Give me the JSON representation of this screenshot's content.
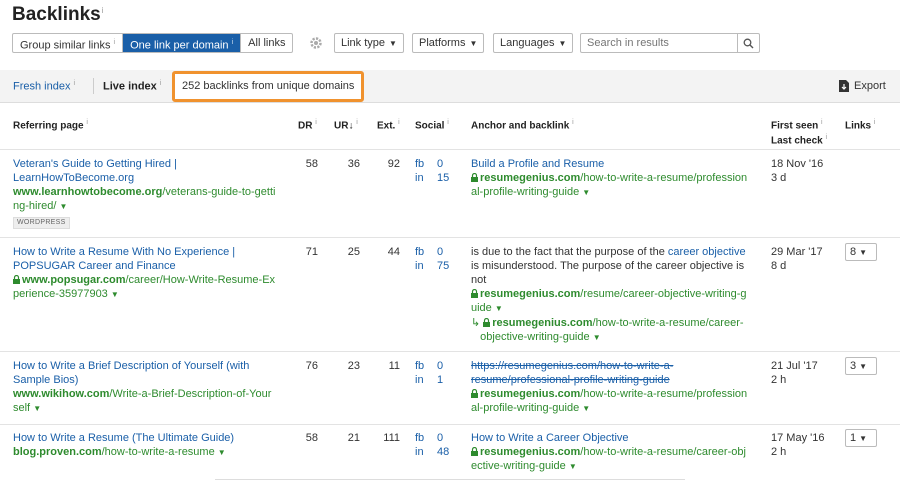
{
  "page": {
    "title": "Backlinks"
  },
  "toolbar": {
    "group_similar": "Group similar links",
    "one_link": "One link per domain",
    "all_links": "All links",
    "link_type": "Link type",
    "platforms": "Platforms",
    "languages": "Languages",
    "search_placeholder": "Search in results"
  },
  "subbar": {
    "fresh": "Fresh index",
    "live": "Live index",
    "count": "252 backlinks from unique domains",
    "export": "Export"
  },
  "columns": {
    "referring": "Referring page",
    "dr": "DR",
    "ur": "UR",
    "ur_sort": "↓",
    "ext": "Ext.",
    "social": "Social",
    "anchor": "Anchor and backlink",
    "first_seen": "First seen",
    "last_check": "Last check",
    "links": "Links"
  },
  "info_mark": "i",
  "rows": [
    {
      "title1": "Veteran's Guide to Getting Hired |",
      "title2": "LearnHowToBecome.org",
      "url_domain": "www.learnhowtobecome.org",
      "url_path1": "/veterans-guide-to-getti",
      "url_path2": "ng-hired/",
      "badge": "WORDPRESS",
      "dr": "58",
      "ur": "36",
      "ext": "92",
      "fb_label": "fb",
      "fb": "0",
      "in_label": "in",
      "in": "15",
      "anchor": "Build a Profile and Resume",
      "bl_domain": "resumegenius.com",
      "bl_path1": "/how-to-write-a-resume/profession",
      "bl_path2": "al-profile-writing-guide",
      "first_seen": "18 Nov '16",
      "last_check": "3 d"
    },
    {
      "title1": "How to Write a Resume With No Experience |",
      "title2": "POPSUGAR Career and Finance",
      "url_domain": "www.popsugar.com",
      "url_path1": "/career/How-Write-Resume-Ex",
      "url_path2": "perience-35977903",
      "dr": "71",
      "ur": "25",
      "ext": "44",
      "fb_label": "fb",
      "fb": "0",
      "in_label": "in",
      "in": "75",
      "ctx1": "is due to the fact that the purpose of the ",
      "ctx_link": "career objective",
      "ctx2": "is misunderstood. The purpose of the career objective is",
      "ctx3": "not",
      "bl_domain": "resumegenius.com",
      "bl_path1": "/resume/career-objective-writing-g",
      "bl_path2": "uide",
      "redir_domain": "resumegenius.com",
      "redir_path1": "/how-to-write-a-resume/career-",
      "redir_path2": "objective-writing-guide",
      "first_seen": "29 Mar '17",
      "last_check": "8 d",
      "links": "8"
    },
    {
      "title1": "How to Write a Brief Description of Yourself (with",
      "title2": "Sample Bios)",
      "url_domain": "www.wikihow.com",
      "url_path1": "/Write-a-Brief-Description-of-Your",
      "url_path2": "self",
      "dr": "76",
      "ur": "23",
      "ext": "11",
      "fb_label": "fb",
      "fb": "0",
      "in_label": "in",
      "in": "1",
      "old1": "https://resumegenius.com/how-to-write-a-",
      "old2": "resume/professional-profile-writing-guide",
      "bl_domain": "resumegenius.com",
      "bl_path1": "/how-to-write-a-resume/profession",
      "bl_path2": "al-profile-writing-guide",
      "first_seen": "21 Jul '17",
      "last_check": "2 h",
      "links": "3"
    },
    {
      "title1": "How to Write a Resume (The Ultimate Guide)",
      "url_domain": "blog.proven.com",
      "url_path1": "/how-to-write-a-resume",
      "dr": "58",
      "ur": "21",
      "ext": "111",
      "fb_label": "fb",
      "fb": "0",
      "in_label": "in",
      "in": "48",
      "anchor": "How to Write a Career Objective",
      "bl_domain": "resumegenius.com",
      "bl_path1": "/how-to-write-a-resume/career-obj",
      "bl_path2": "ective-writing-guide",
      "first_seen": "17 May '16",
      "last_check": "2 h",
      "links": "1"
    }
  ]
}
